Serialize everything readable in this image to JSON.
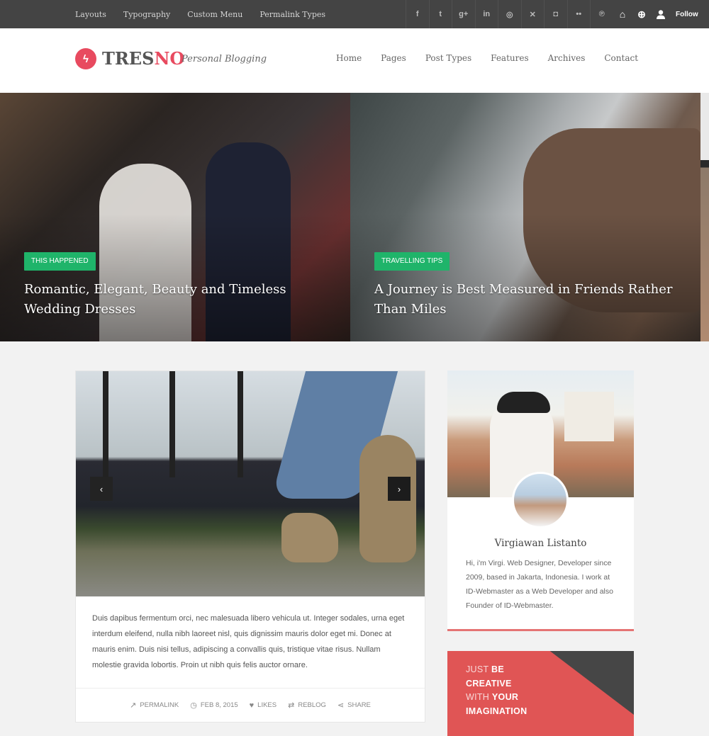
{
  "topbar": {
    "nav": [
      "Layouts",
      "Typography",
      "Custom Menu",
      "Permalink Types"
    ],
    "social_icons": [
      {
        "name": "facebook-icon",
        "glyph": "f"
      },
      {
        "name": "twitter-icon",
        "glyph": "t"
      },
      {
        "name": "google-plus-icon",
        "glyph": "g+"
      },
      {
        "name": "linkedin-icon",
        "glyph": "in"
      },
      {
        "name": "dribbble-icon",
        "glyph": "◎"
      },
      {
        "name": "xing-icon",
        "glyph": "✕"
      },
      {
        "name": "instagram-icon",
        "glyph": "◘"
      },
      {
        "name": "flickr-icon",
        "glyph": "••"
      },
      {
        "name": "pinterest-icon",
        "glyph": "℗"
      }
    ],
    "extra_icons": [
      {
        "name": "home-icon",
        "glyph": "⌂"
      },
      {
        "name": "add-icon",
        "glyph": "⊕"
      },
      {
        "name": "user-icon",
        "glyph": "👤"
      }
    ],
    "follow_label": "Follow"
  },
  "header": {
    "logo_icon": "ϟ",
    "logo_main": "TRES",
    "logo_accent": "NO",
    "tagline": "Personal Blogging",
    "nav": [
      "Home",
      "Pages",
      "Post Types",
      "Features",
      "Archives",
      "Contact"
    ],
    "accent_color": "#e84a5f"
  },
  "hero": [
    {
      "category": "THIS HAPPENED",
      "title": "Romantic, Elegant, Beauty and Timeless Wedding Dresses"
    },
    {
      "category": "TRAVELLING TIPS",
      "title": "A Journey is Best Measured in Friends Rather Than Miles"
    }
  ],
  "post": {
    "prev_label": "‹",
    "next_label": "›",
    "excerpt": "Duis dapibus fermentum orci, nec malesuada libero vehicula ut. Integer sodales, urna eget interdum eleifend, nulla nibh laoreet nisl, quis dignissim mauris dolor eget mi. Donec at mauris enim. Duis nisi tellus, adipiscing a convallis quis, tristique vitae risus. Nullam molestie gravida lobortis. Proin ut nibh quis felis auctor ornare.",
    "meta": [
      {
        "icon": "external-link-icon",
        "glyph": "↗",
        "label": "PERMALINK"
      },
      {
        "icon": "clock-icon",
        "glyph": "◷",
        "label": "FEB 8, 2015"
      },
      {
        "icon": "heart-icon",
        "glyph": "♥",
        "label": "LIKES"
      },
      {
        "icon": "reblog-icon",
        "glyph": "⇄",
        "label": "REBLOG"
      },
      {
        "icon": "share-icon",
        "glyph": "⋖",
        "label": "SHARE"
      }
    ]
  },
  "author": {
    "name": "Virgiawan Listanto",
    "bio": "Hi, i'm Virgi. Web Designer, Developer since 2009, based in Jakarta, Indonesia. I work at ID-Webmaster as a Web Developer and also Founder of ID-Webmaster."
  },
  "promo": {
    "line1_light": "JUST ",
    "line1_bold": "BE",
    "line2_bold": "CREATIVE",
    "line3_light": "WITH ",
    "line3_bold": "YOUR",
    "line4_bold": "IMAGINATION"
  },
  "colors": {
    "topbar_bg": "#444444",
    "badge_green": "#1fb46a",
    "promo_red": "#e05555",
    "author_border": "#e57373"
  }
}
